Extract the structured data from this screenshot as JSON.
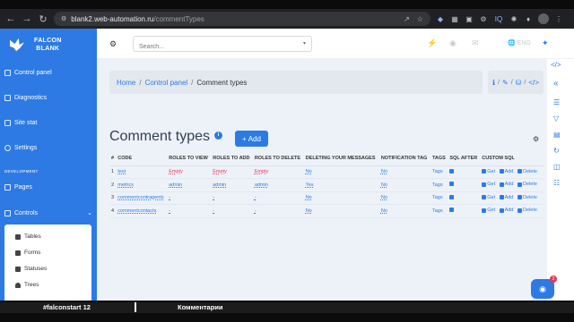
{
  "browser": {
    "url_host": "blank2.web-automation.ru",
    "url_path": "/commentTypes",
    "extensions": [
      "IQ"
    ]
  },
  "sidebar": {
    "brand_line1": "FALCON",
    "brand_line2": "BLANK",
    "items": [
      {
        "label": "Control panel"
      },
      {
        "label": "Diagnostics"
      },
      {
        "label": "Site stat"
      },
      {
        "label": "Settings"
      }
    ],
    "section_label": "DEVELOPMENT",
    "dev_items": [
      {
        "label": "Pages"
      },
      {
        "label": "Controls"
      }
    ],
    "submenu": [
      {
        "label": "Tables"
      },
      {
        "label": "Forms"
      },
      {
        "label": "Statuses"
      },
      {
        "label": "Trees"
      }
    ]
  },
  "topbar": {
    "search_placeholder": "Search...",
    "language": "ENG"
  },
  "breadcrumb": {
    "home": "Home",
    "control_panel": "Control panel",
    "current": "Comment types"
  },
  "page": {
    "title": "Comment types",
    "add_label": "Add"
  },
  "table": {
    "headers": [
      "#",
      "CODE",
      "ROLES TO VIEW",
      "ROLES TO ADD",
      "ROLES TO DELETE",
      "DELETING YOUR MESSAGES",
      "NOTIFICATION TAG",
      "TAGS",
      "SQL AFTER",
      "CUSTOM SQL"
    ],
    "rows": [
      {
        "num": "1",
        "code": "test",
        "view": "Empty",
        "add": "Empty",
        "del": "Empty",
        "deleting": "No",
        "notif": "No",
        "tags": "Tags"
      },
      {
        "num": "2",
        "code": "metrics",
        "view": "admin",
        "add": "admin",
        "del": "admin",
        "deleting": "Yes",
        "notif": "No",
        "tags": "Tags"
      },
      {
        "num": "3",
        "code": "commentcontragents",
        "view": "-",
        "add": "-",
        "del": "-",
        "deleting": "No",
        "notif": "No",
        "tags": "Tags"
      },
      {
        "num": "4",
        "code": "commentcontacts",
        "view": "-",
        "add": "-",
        "del": "-",
        "deleting": "No",
        "notif": "No",
        "tags": "Tags"
      }
    ],
    "action_get": "Get",
    "action_add": "Add",
    "action_delete": "Delete"
  },
  "chat": {
    "badge": "2"
  },
  "footer": {
    "tag": "#falconstart 12",
    "caption": "Комментарии"
  },
  "colors": {
    "accent": "#2c7be5",
    "sidebar": "#2d7ae5",
    "danger": "#e63757",
    "background": "#edf2f9"
  }
}
